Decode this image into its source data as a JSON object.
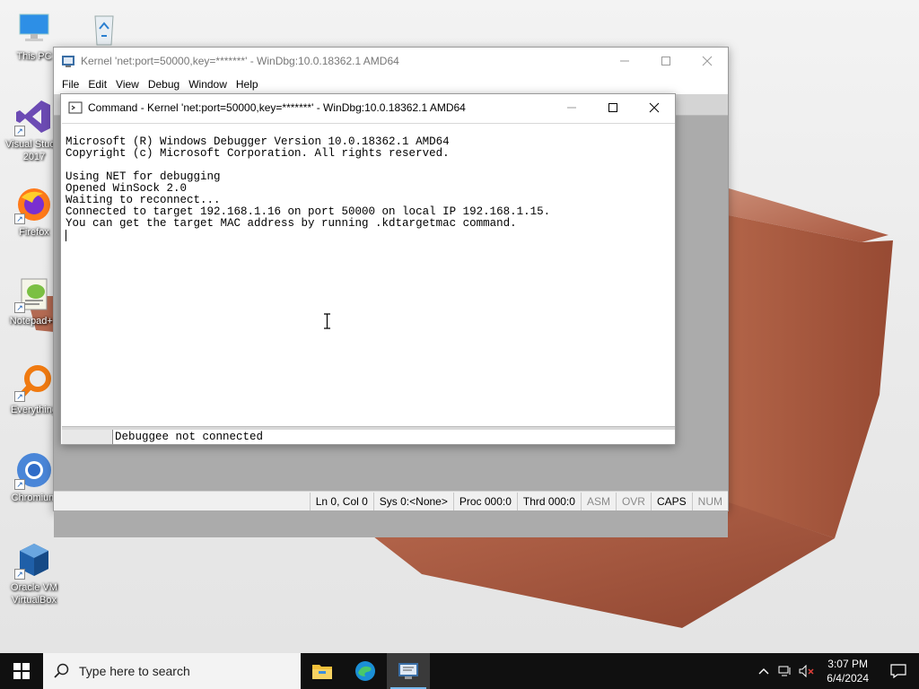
{
  "desktop": {
    "icons": [
      {
        "label": "This PC"
      },
      {
        "label": ""
      },
      {
        "label": "Visual Studio 2017"
      },
      {
        "label": "Firefox"
      },
      {
        "label": "Notepad++"
      },
      {
        "label": "Everything"
      },
      {
        "label": "Chromium"
      },
      {
        "label": "Oracle VM VirtualBox"
      }
    ]
  },
  "main_window": {
    "title": "Kernel 'net:port=50000,key=*******' - WinDbg:10.0.18362.1 AMD64",
    "menu": [
      "File",
      "Edit",
      "View",
      "Debug",
      "Window",
      "Help"
    ],
    "status": {
      "ln_col": "Ln 0, Col 0",
      "sys": "Sys 0:<None>",
      "proc": "Proc 000:0",
      "thrd": "Thrd 000:0",
      "asm": "ASM",
      "ovr": "OVR",
      "caps": "CAPS",
      "num": "NUM"
    }
  },
  "command_window": {
    "title": "Command - Kernel 'net:port=50000,key=*******' - WinDbg:10.0.18362.1 AMD64",
    "output": "Microsoft (R) Windows Debugger Version 10.0.18362.1 AMD64\nCopyright (c) Microsoft Corporation. All rights reserved.\n\nUsing NET for debugging\nOpened WinSock 2.0\nWaiting to reconnect...\nConnected to target 192.168.1.16 on port 50000 on local IP 192.168.1.15.\nYou can get the target MAC address by running .kdtargetmac command.",
    "input_status": "Debuggee not connected"
  },
  "taskbar": {
    "search_placeholder": "Type here to search",
    "clock_time": "3:07 PM",
    "clock_date": "6/4/2024"
  },
  "colors": {
    "taskbar": "#101010",
    "mdi_background": "#ababab",
    "brick": "#b5654a"
  }
}
